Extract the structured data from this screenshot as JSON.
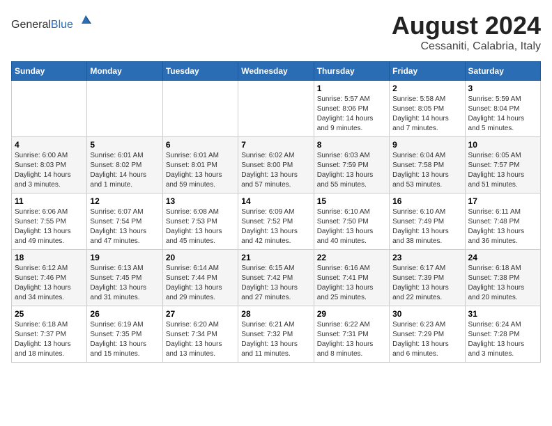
{
  "header": {
    "logo_general": "General",
    "logo_blue": "Blue",
    "month": "August 2024",
    "location": "Cessaniti, Calabria, Italy"
  },
  "weekdays": [
    "Sunday",
    "Monday",
    "Tuesday",
    "Wednesday",
    "Thursday",
    "Friday",
    "Saturday"
  ],
  "weeks": [
    [
      {
        "day": "",
        "info": ""
      },
      {
        "day": "",
        "info": ""
      },
      {
        "day": "",
        "info": ""
      },
      {
        "day": "",
        "info": ""
      },
      {
        "day": "1",
        "info": "Sunrise: 5:57 AM\nSunset: 8:06 PM\nDaylight: 14 hours\nand 9 minutes."
      },
      {
        "day": "2",
        "info": "Sunrise: 5:58 AM\nSunset: 8:05 PM\nDaylight: 14 hours\nand 7 minutes."
      },
      {
        "day": "3",
        "info": "Sunrise: 5:59 AM\nSunset: 8:04 PM\nDaylight: 14 hours\nand 5 minutes."
      }
    ],
    [
      {
        "day": "4",
        "info": "Sunrise: 6:00 AM\nSunset: 8:03 PM\nDaylight: 14 hours\nand 3 minutes."
      },
      {
        "day": "5",
        "info": "Sunrise: 6:01 AM\nSunset: 8:02 PM\nDaylight: 14 hours\nand 1 minute."
      },
      {
        "day": "6",
        "info": "Sunrise: 6:01 AM\nSunset: 8:01 PM\nDaylight: 13 hours\nand 59 minutes."
      },
      {
        "day": "7",
        "info": "Sunrise: 6:02 AM\nSunset: 8:00 PM\nDaylight: 13 hours\nand 57 minutes."
      },
      {
        "day": "8",
        "info": "Sunrise: 6:03 AM\nSunset: 7:59 PM\nDaylight: 13 hours\nand 55 minutes."
      },
      {
        "day": "9",
        "info": "Sunrise: 6:04 AM\nSunset: 7:58 PM\nDaylight: 13 hours\nand 53 minutes."
      },
      {
        "day": "10",
        "info": "Sunrise: 6:05 AM\nSunset: 7:57 PM\nDaylight: 13 hours\nand 51 minutes."
      }
    ],
    [
      {
        "day": "11",
        "info": "Sunrise: 6:06 AM\nSunset: 7:55 PM\nDaylight: 13 hours\nand 49 minutes."
      },
      {
        "day": "12",
        "info": "Sunrise: 6:07 AM\nSunset: 7:54 PM\nDaylight: 13 hours\nand 47 minutes."
      },
      {
        "day": "13",
        "info": "Sunrise: 6:08 AM\nSunset: 7:53 PM\nDaylight: 13 hours\nand 45 minutes."
      },
      {
        "day": "14",
        "info": "Sunrise: 6:09 AM\nSunset: 7:52 PM\nDaylight: 13 hours\nand 42 minutes."
      },
      {
        "day": "15",
        "info": "Sunrise: 6:10 AM\nSunset: 7:50 PM\nDaylight: 13 hours\nand 40 minutes."
      },
      {
        "day": "16",
        "info": "Sunrise: 6:10 AM\nSunset: 7:49 PM\nDaylight: 13 hours\nand 38 minutes."
      },
      {
        "day": "17",
        "info": "Sunrise: 6:11 AM\nSunset: 7:48 PM\nDaylight: 13 hours\nand 36 minutes."
      }
    ],
    [
      {
        "day": "18",
        "info": "Sunrise: 6:12 AM\nSunset: 7:46 PM\nDaylight: 13 hours\nand 34 minutes."
      },
      {
        "day": "19",
        "info": "Sunrise: 6:13 AM\nSunset: 7:45 PM\nDaylight: 13 hours\nand 31 minutes."
      },
      {
        "day": "20",
        "info": "Sunrise: 6:14 AM\nSunset: 7:44 PM\nDaylight: 13 hours\nand 29 minutes."
      },
      {
        "day": "21",
        "info": "Sunrise: 6:15 AM\nSunset: 7:42 PM\nDaylight: 13 hours\nand 27 minutes."
      },
      {
        "day": "22",
        "info": "Sunrise: 6:16 AM\nSunset: 7:41 PM\nDaylight: 13 hours\nand 25 minutes."
      },
      {
        "day": "23",
        "info": "Sunrise: 6:17 AM\nSunset: 7:39 PM\nDaylight: 13 hours\nand 22 minutes."
      },
      {
        "day": "24",
        "info": "Sunrise: 6:18 AM\nSunset: 7:38 PM\nDaylight: 13 hours\nand 20 minutes."
      }
    ],
    [
      {
        "day": "25",
        "info": "Sunrise: 6:18 AM\nSunset: 7:37 PM\nDaylight: 13 hours\nand 18 minutes."
      },
      {
        "day": "26",
        "info": "Sunrise: 6:19 AM\nSunset: 7:35 PM\nDaylight: 13 hours\nand 15 minutes."
      },
      {
        "day": "27",
        "info": "Sunrise: 6:20 AM\nSunset: 7:34 PM\nDaylight: 13 hours\nand 13 minutes."
      },
      {
        "day": "28",
        "info": "Sunrise: 6:21 AM\nSunset: 7:32 PM\nDaylight: 13 hours\nand 11 minutes."
      },
      {
        "day": "29",
        "info": "Sunrise: 6:22 AM\nSunset: 7:31 PM\nDaylight: 13 hours\nand 8 minutes."
      },
      {
        "day": "30",
        "info": "Sunrise: 6:23 AM\nSunset: 7:29 PM\nDaylight: 13 hours\nand 6 minutes."
      },
      {
        "day": "31",
        "info": "Sunrise: 6:24 AM\nSunset: 7:28 PM\nDaylight: 13 hours\nand 3 minutes."
      }
    ]
  ]
}
